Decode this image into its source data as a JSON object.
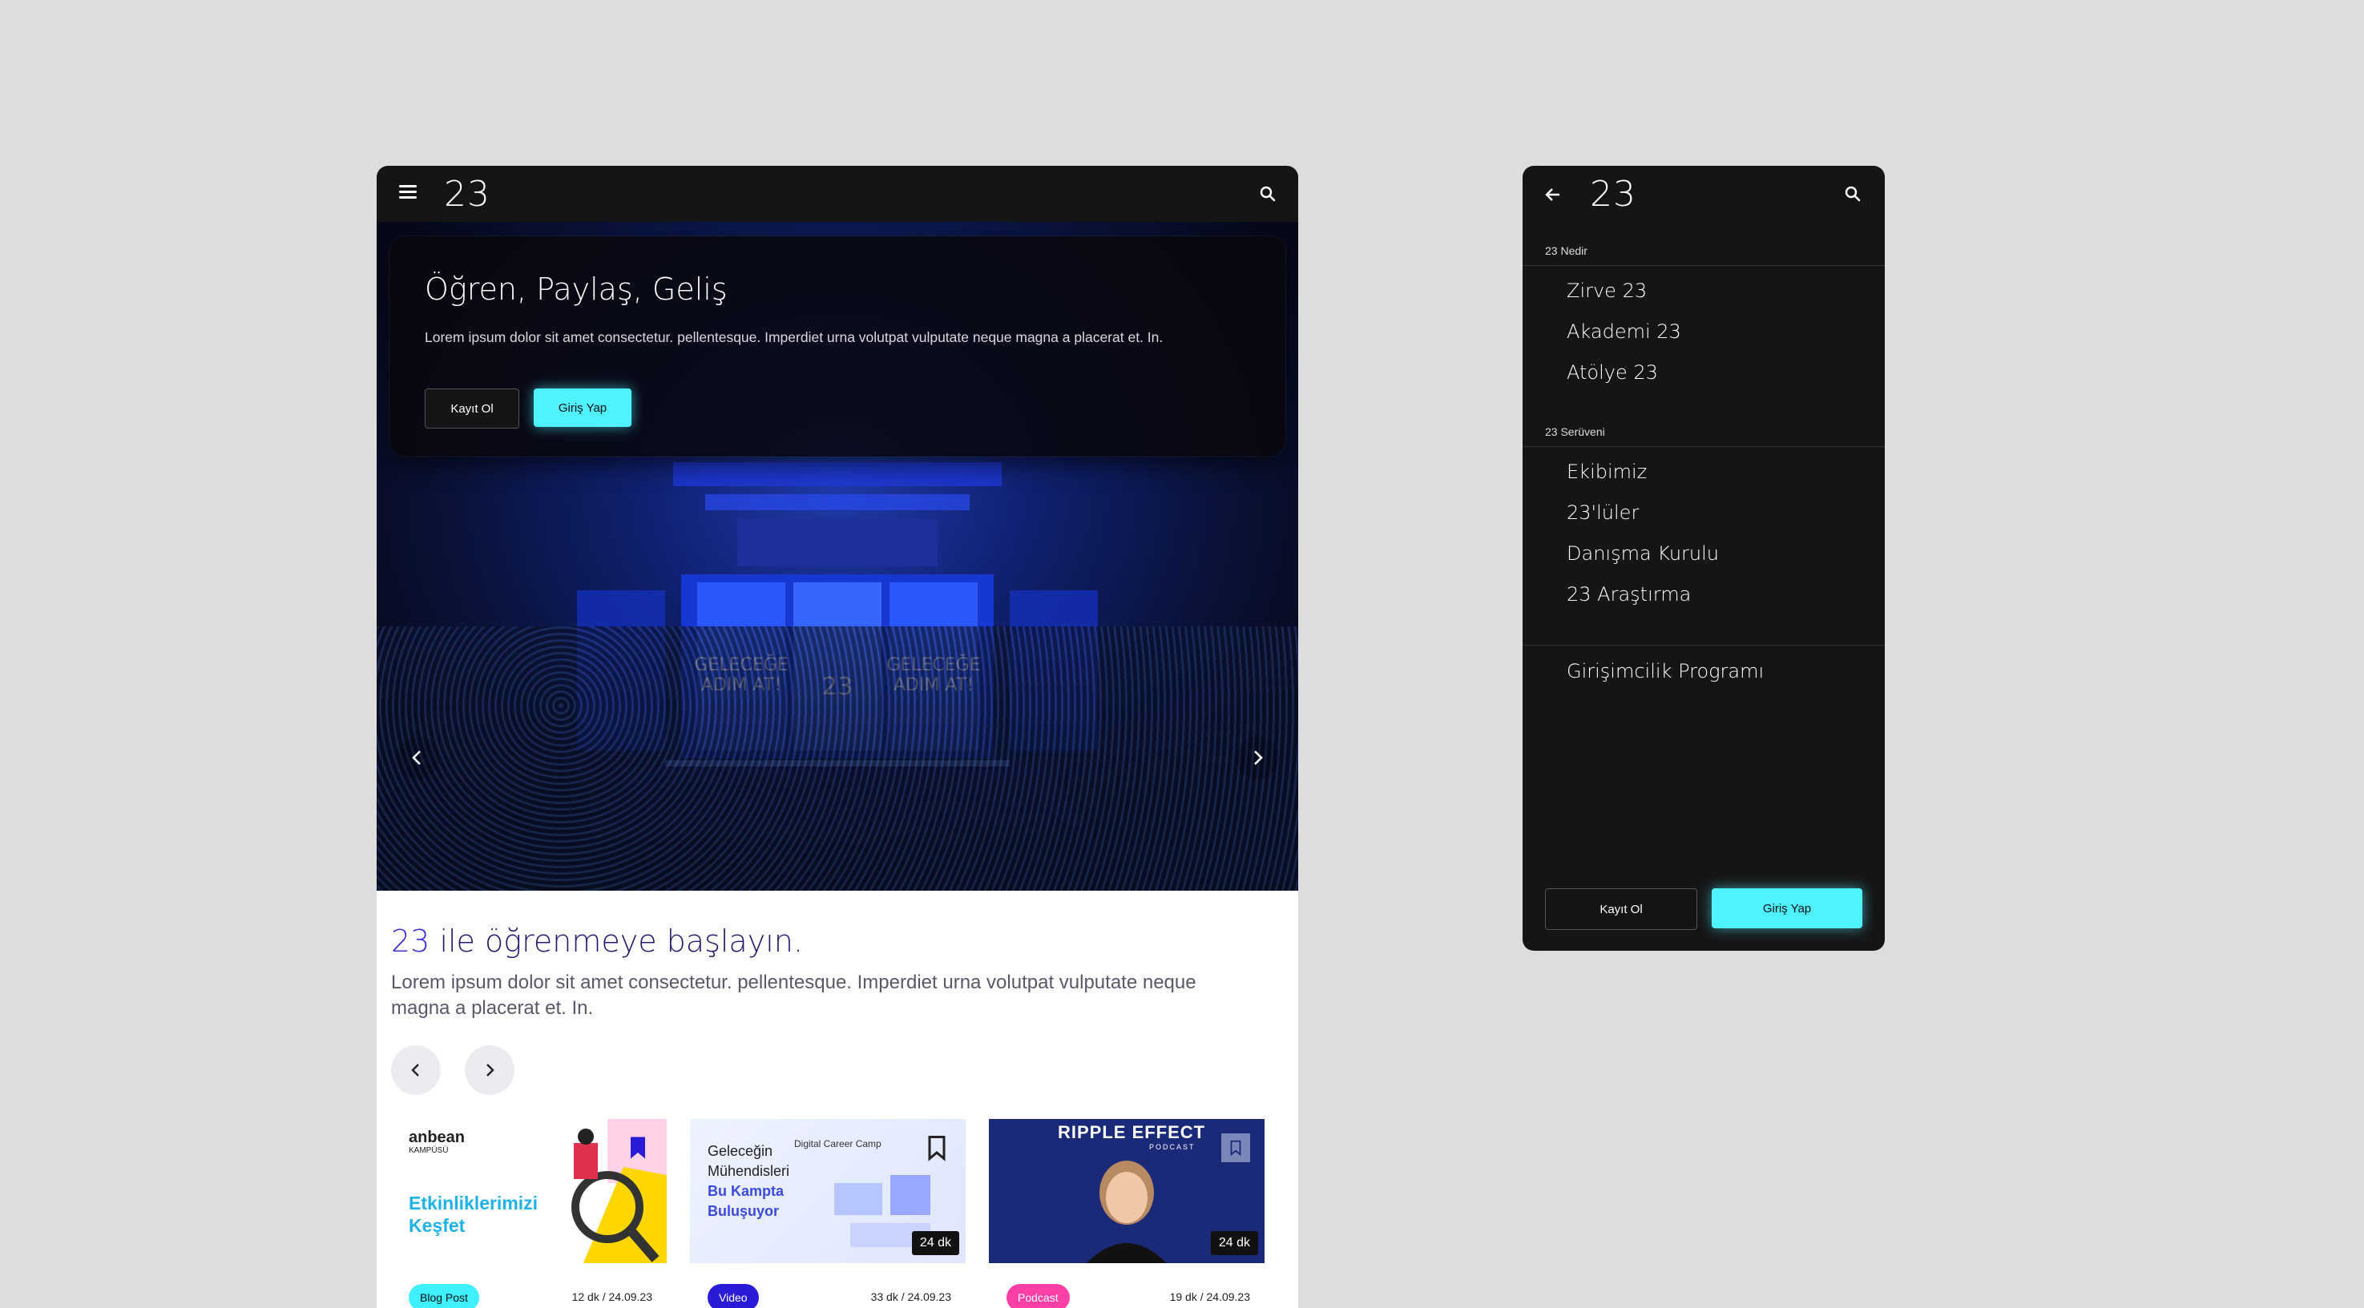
{
  "main": {
    "logo": "23",
    "hero": {
      "title": "Öğren, Paylaş, Geliş",
      "description": "Lorem ipsum dolor sit amet consectetur. pellentesque. Imperdiet urna volutpat vulputate neque magna a placerat et. In.",
      "register_label": "Kayıt Ol",
      "login_label": "Giriş Yap"
    },
    "section": {
      "title_number": "23",
      "title_rest": " ile öğrenmeye başlayın.",
      "description": "Lorem ipsum dolor sit amet consectetur. pellentesque. Imperdiet urna volutpat vulputate neque magna a placerat et. In."
    },
    "cards": [
      {
        "badge": "Blog Post",
        "meta": "12 dk  /  24.09.23",
        "thumb_brand": "anbean",
        "thumb_brand_sub": "KAMPÜSÜ",
        "thumb_text_1": "Etkinliklerimizi",
        "thumb_text_2": "Keşfet"
      },
      {
        "badge": "Video",
        "meta": "33 dk  /  24.09.23",
        "duration": "24 dk",
        "thumb_brand": "Digital Career Camp",
        "thumb_text_1": "Geleceğin",
        "thumb_text_2": "Mühendisleri",
        "thumb_text_3": "Bu Kampta",
        "thumb_text_4": "Buluşuyor"
      },
      {
        "badge": "Podcast",
        "meta": "19 dk  /  24.09.23",
        "duration": "24 dk",
        "thumb_brand": "RIPPLE EFFECT",
        "thumb_brand_sub": "PODCAST"
      }
    ]
  },
  "menu": {
    "logo": "23",
    "section_1": "23 Nedir",
    "items_1": [
      "Zirve 23",
      "Akademi 23",
      "Atölye 23"
    ],
    "section_2": "23 Serüveni",
    "items_2": [
      "Ekibimiz",
      "23'lüler",
      "Danışma Kurulu",
      "23 Araştırma"
    ],
    "items_3": [
      "Girişimcilik Programı"
    ],
    "register_label": "Kayıt Ol",
    "login_label": "Giriş Yap"
  },
  "colors": {
    "accent_cyan": "#4ff2ff",
    "dark": "#151516",
    "title_purple": "#2a1b6e",
    "badge_cyan": "#3ff0ff",
    "badge_blue": "#2a1bd8",
    "badge_pink": "#ff3fa8"
  }
}
